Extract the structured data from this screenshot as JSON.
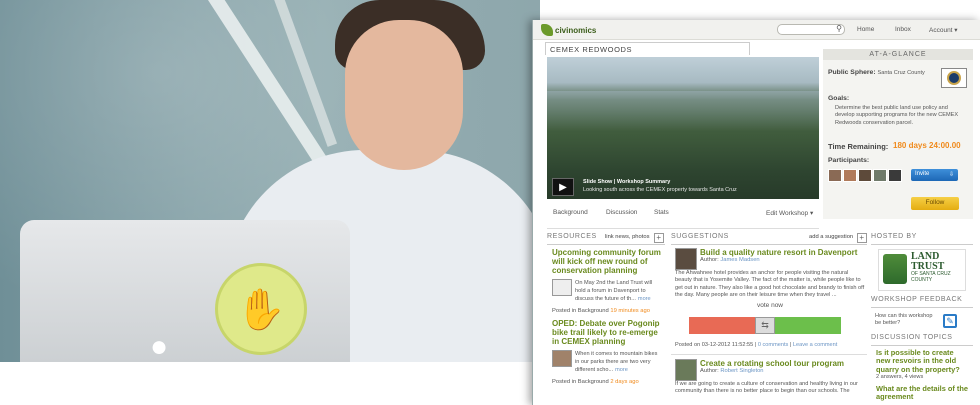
{
  "topbar": {
    "logo_text": "civinomics",
    "nav": [
      "Home",
      "Inbox",
      "Account ▾"
    ]
  },
  "workshop": {
    "title": "CEMEX REDWOODS",
    "slideshow_label": "Slide Show  |  Workshop Summary",
    "slideshow_caption": "Looking south across the CEMEX property towards Santa Cruz",
    "tabs": [
      "Background",
      "Discussion",
      "Stats"
    ],
    "edit_label": "Edit Workshop ▾"
  },
  "glance": {
    "heading": "AT-A-GLANCE",
    "sphere_label": "Public Sphere:",
    "sphere_value": "Santa Cruz County",
    "goals_label": "Goals:",
    "goals_text": "Determine the best public land use policy and develop supporting programs for the new CEMEX Redwoods conservation parcel.",
    "time_label": "Time Remaining:",
    "time_value": "180 days 24:00.00",
    "participants_label": "Participants:",
    "invite_label": "Invite",
    "follow_label": "Follow"
  },
  "resources": {
    "heading": "RESOURCES",
    "link_text": "link news, photos",
    "items": [
      {
        "title": "Upcoming community forum will kick off new round of conservation planning",
        "snippet": "On May 2nd the Land Trust will hold a forum in Davenport to discuss the future of th...",
        "more": "more",
        "posted_in": "Posted in Background",
        "ago": "19 minutes ago"
      },
      {
        "title": "OPED: Debate over Pogonip bike trail likely to re-emerge in CEMEX planning",
        "snippet": "When it comes to mountain bikes in our parks there are two very different scho...",
        "more": "more",
        "posted_in": "Posted in Background",
        "ago": "2 days ago"
      }
    ]
  },
  "suggestions": {
    "heading": "SUGGESTIONS",
    "add_label": "add a suggestion",
    "items": [
      {
        "title": "Build a quality nature resort in Davenport",
        "author_label": "Author:",
        "author": "James Madsen",
        "body": "The Ahwahnee hotel provides an anchor for people visiting the natural beauty that is Yosemite Valley. The fact of the matter is, while people like to get out in nature. They also like a good hot chocolate and brandy to finish off the day. Many people are on their leisure time when they travel ...",
        "vote_label": "vote now",
        "posted_on": "Posted on 03-12-2012 11:52:55",
        "comments": "0 comments",
        "leave": "Leave a comment"
      },
      {
        "title": "Create a rotating school tour program",
        "author_label": "Author:",
        "author": "Robert Singleton",
        "body": "If we are going to create a culture of conservation and healthy living in our community than there is no better place to begin than our schools. The"
      }
    ]
  },
  "sidebar": {
    "hosted_heading": "HOSTED BY",
    "land_trust": "LAND TRUST",
    "land_trust_sub": "OF SANTA CRUZ COUNTY",
    "feedback_heading": "WORKSHOP FEEDBACK",
    "feedback_text": "How can this workshop be better?",
    "topics_heading": "DISCUSSION TOPICS",
    "topics": [
      {
        "title": "Is it possible to create new resvoirs in the old quarry on the property?",
        "meta": "2 answers, 4 views"
      },
      {
        "title": "What are the details of the agreement"
      }
    ]
  }
}
